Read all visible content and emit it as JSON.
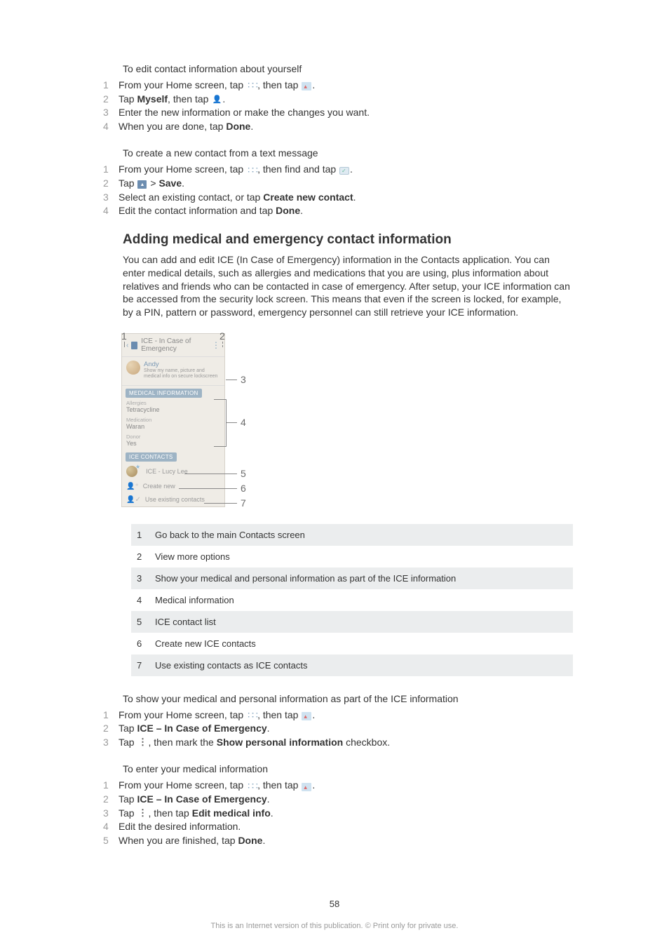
{
  "sections": {
    "s1": {
      "title": "To edit contact information about yourself",
      "steps": {
        "n1": "1",
        "t1a": "From your Home screen, tap ",
        "t1b": ", then tap ",
        "t1c": ".",
        "n2": "2",
        "t2a": "Tap ",
        "t2b": "Myself",
        "t2c": ", then tap ",
        "t2d": ".",
        "n3": "3",
        "t3": "Enter the new information or make the changes you want.",
        "n4": "4",
        "t4a": "When you are done, tap ",
        "t4b": "Done",
        "t4c": "."
      }
    },
    "s2": {
      "title": "To create a new contact from a text message",
      "steps": {
        "n1": "1",
        "t1a": "From your Home screen, tap ",
        "t1b": ", then find and tap ",
        "t1c": ".",
        "n2": "2",
        "t2a": "Tap ",
        "t2b": " > ",
        "t2c": "Save",
        "t2d": ".",
        "n3": "3",
        "t3a": "Select an existing contact, or tap ",
        "t3b": "Create new contact",
        "t3c": ".",
        "n4": "4",
        "t4a": "Edit the contact information and tap ",
        "t4b": "Done",
        "t4c": "."
      }
    },
    "heading": "Adding medical and emergency contact information",
    "para": "You can add and edit ICE (In Case of Emergency) information in the Contacts application. You can enter medical details, such as allergies and medications that you are using, plus information about relatives and friends who can be contacted in case of emergency. After setup, your ICE information can be accessed from the security lock screen. This means that even if the screen is locked, for example, by a PIN, pattern or password, emergency personnel can still retrieve your ICE information.",
    "diagram": {
      "c1": "1",
      "c2": "2",
      "c3": "3",
      "c4": "4",
      "c5": "5",
      "c6": "6",
      "c7": "7",
      "header": "ICE - In Case of Emergency",
      "user_name": "Andy",
      "user_sub": "Show my name, picture and medical info on secure lockscreen",
      "pill_medical": "MEDICAL INFORMATION",
      "allergies_label": "Allergies",
      "allergies_val": "Tetracycline",
      "medication_label": "Medication",
      "medication_val": "Waran",
      "donor_label": "Donor",
      "donor_val": "Yes",
      "pill_ice": "ICE CONTACTS",
      "ice_contact": "ICE - Lucy Lee",
      "create_new": "Create new",
      "use_existing": "Use existing contacts"
    },
    "legend": {
      "r1n": "1",
      "r1": "Go back to the main Contacts screen",
      "r2n": "2",
      "r2": "View more options",
      "r3n": "3",
      "r3": "Show your medical and personal information as part of the ICE information",
      "r4n": "4",
      "r4": "Medical information",
      "r5n": "5",
      "r5": "ICE contact list",
      "r6n": "6",
      "r6": "Create new ICE contacts",
      "r7n": "7",
      "r7": "Use existing contacts as ICE contacts"
    },
    "s3": {
      "title": "To show your medical and personal information as part of the ICE information",
      "steps": {
        "n1": "1",
        "t1a": "From your Home screen, tap ",
        "t1b": ", then tap ",
        "t1c": ".",
        "n2": "2",
        "t2a": "Tap ",
        "t2b": "ICE – In Case of Emergency",
        "t2c": ".",
        "n3": "3",
        "t3a": "Tap ",
        "t3b": ", then mark the ",
        "t3c": "Show personal information",
        "t3d": " checkbox."
      }
    },
    "s4": {
      "title": "To enter your medical information",
      "steps": {
        "n1": "1",
        "t1a": "From your Home screen, tap ",
        "t1b": ", then tap ",
        "t1c": ".",
        "n2": "2",
        "t2a": "Tap ",
        "t2b": "ICE – In Case of Emergency",
        "t2c": ".",
        "n3": "3",
        "t3a": "Tap ",
        "t3b": ", then tap ",
        "t3c": "Edit medical info",
        "t3d": ".",
        "n4": "4",
        "t4": "Edit the desired information.",
        "n5": "5",
        "t5a": "When you are finished, tap ",
        "t5b": "Done",
        "t5c": "."
      }
    }
  },
  "page_number": "58",
  "footer": "This is an Internet version of this publication. © Print only for private use."
}
